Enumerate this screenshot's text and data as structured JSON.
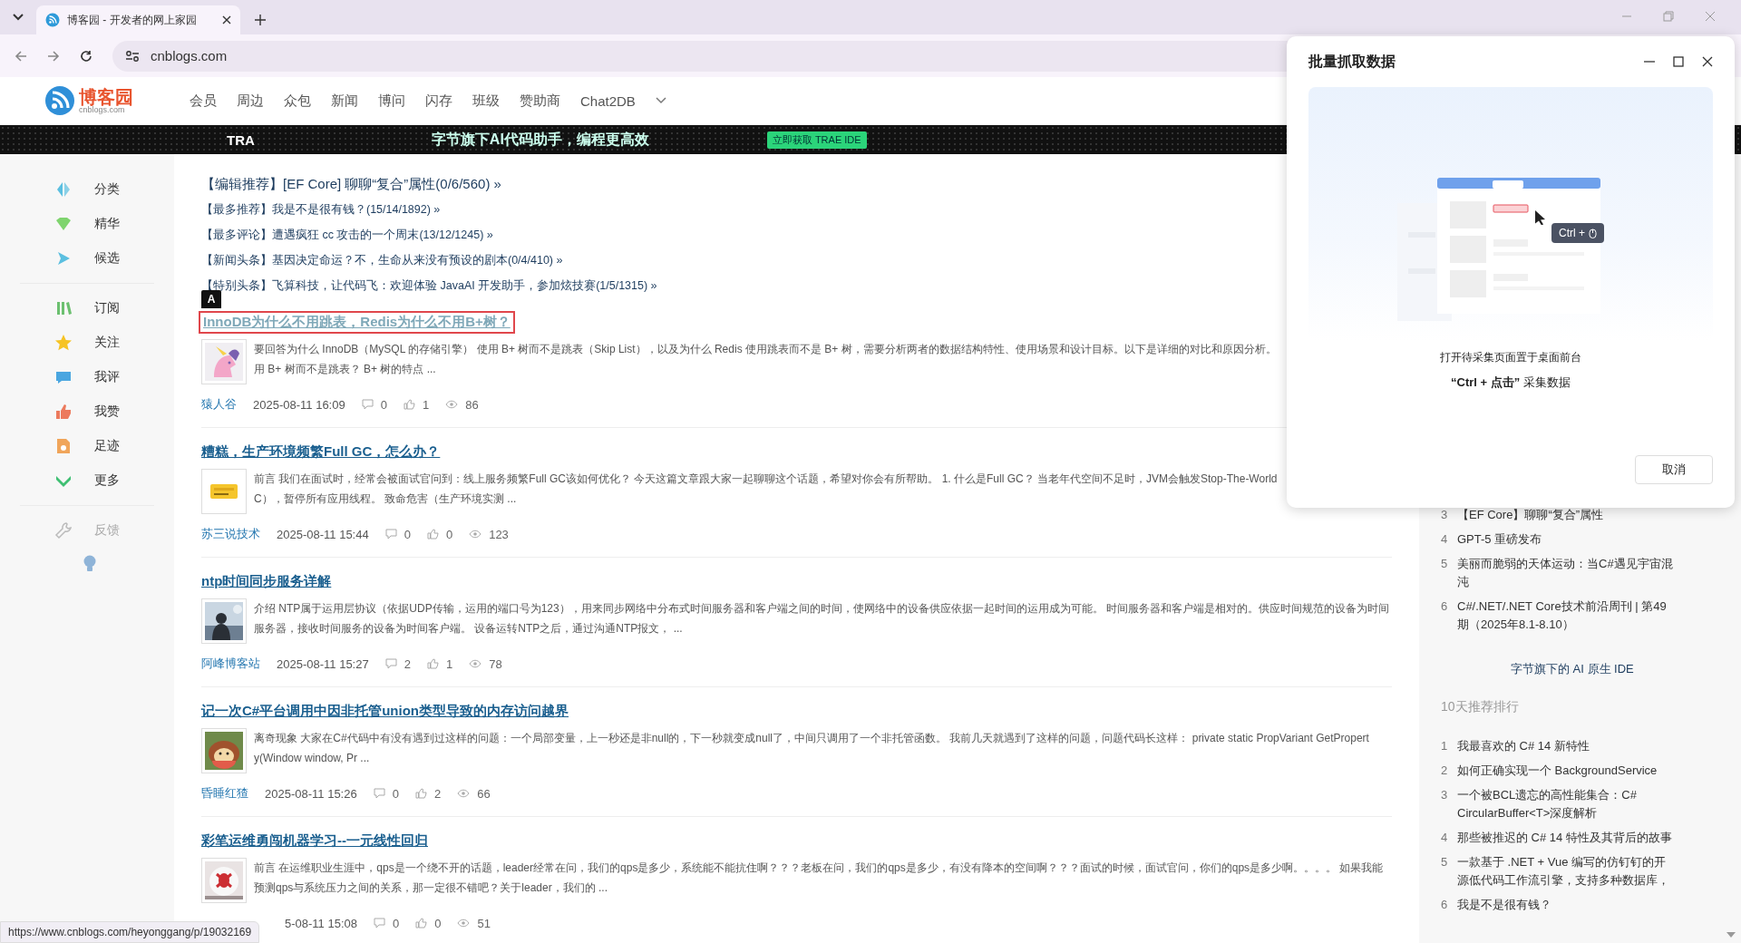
{
  "browser": {
    "tab_title": "博客园 - 开发者的网上家园",
    "url": "cnblogs.com"
  },
  "site": {
    "logo_text": "博客园",
    "logo_sub": "cnblogs.com",
    "nav": [
      "会员",
      "周边",
      "众包",
      "新闻",
      "博问",
      "闪存",
      "班级",
      "赞助商",
      "Chat2DB"
    ]
  },
  "banner": {
    "brand": "TRA",
    "slogan": "字节旗下AI代码助手，编程更高效",
    "cta": "立即获取 TRAE IDE"
  },
  "sidebar": {
    "groups": [
      [
        {
          "label": "分类",
          "disabled": false
        },
        {
          "label": "精华",
          "disabled": false
        },
        {
          "label": "候选",
          "disabled": false
        }
      ],
      [
        {
          "label": "订阅",
          "disabled": false
        },
        {
          "label": "关注",
          "disabled": false
        },
        {
          "label": "我评",
          "disabled": false
        },
        {
          "label": "我赞",
          "disabled": false
        },
        {
          "label": "足迹",
          "disabled": false
        },
        {
          "label": "更多",
          "disabled": false
        }
      ],
      [
        {
          "label": "反馈",
          "disabled": true
        }
      ]
    ]
  },
  "headlines": [
    {
      "tag": "【编辑推荐】",
      "text": "[EF Core] 聊聊“复合”属性(0/6/560) »"
    },
    {
      "tag": "【最多推荐】",
      "text": "我是不是很有钱？(15/14/1892) »"
    },
    {
      "tag": "【最多评论】",
      "text": "遭遇疯狂 cc 攻击的一个周末(13/12/1245) »"
    },
    {
      "tag": "【新闻头条】",
      "text": "基因决定命运？不，生命从来没有预设的剧本(0/4/410) »"
    },
    {
      "tag": "【特别头条】",
      "text": "飞算科技，让代码飞：欢迎体验 JavaAI 开发助手，参加炫技赛(1/5/1315) »"
    }
  ],
  "articles": [
    {
      "title": "InnoDB为什么不用跳表，Redis为什么不用B+树？",
      "highlighted": true,
      "badge": "A",
      "summary_lines": [
        "要回答为什么 InnoDB（MySQL 的存储引擎） 使用 B+ 树而不是跳表（Skip List），以及为什么 Redis 使用跳表而不是 B+ 树，需要分析两者的数据结构特性、使用场景和设计目标。以下是详细的对比和原因分析。",
        "用 B+ 树而不是跳表？ B+ 树的特点 ..."
      ],
      "author": "猿人谷",
      "date": "2025-08-11 16:09",
      "comments": "0",
      "likes": "1",
      "views": "86"
    },
    {
      "title": "糟糕，生产环境频繁Full GC，怎么办？",
      "highlighted": false,
      "summary_lines": [
        "前言 我们在面试时，经常会被面试官问到：线上服务频繁Full GC该如何优化？ 今天这篇文章跟大家一起聊聊这个话题，希望对你会有所帮助。 1. 什么是Full GC？ 当老年代空间不足时，JVM会触发Stop-The-World",
        "C），暂停所有应用线程。 致命危害（生产环境实测 ..."
      ],
      "author": "苏三说技术",
      "date": "2025-08-11 15:44",
      "comments": "0",
      "likes": "0",
      "views": "123"
    },
    {
      "title": "ntp时间同步服务详解",
      "highlighted": false,
      "summary_lines": [
        "介绍 NTP属于运用层协议（依据UDP传输，运用的端口号为123），用来同步网络中分布式时间服务器和客户端之间的时间，使网络中的设备供应依据一起时间的运用成为可能。 时间服务器和客户端是相对的。供应时间规范的设备为时间",
        "服务器，接收时间服务的设备为时间客户端。 设备运转NTP之后，通过沟通NTP报文， ..."
      ],
      "author": "阿峰博客站",
      "date": "2025-08-11 15:27",
      "comments": "2",
      "likes": "1",
      "views": "78"
    },
    {
      "title": "记一次C#平台调用中因非托管union类型导致的内存访问越界",
      "highlighted": false,
      "summary_lines": [
        "离奇现象 大家在C#代码中有没有遇到过这样的问题：一个局部变量，上一秒还是非null的，下一秒就变成null了，中间只调用了一个非托管函数。 我前几天就遇到了这样的问题，问题代码长这样： private static PropVariant GetPropert",
        "y(Window window, Pr ..."
      ],
      "author": "昏睡红猹",
      "date": "2025-08-11 15:26",
      "comments": "0",
      "likes": "2",
      "views": "66"
    },
    {
      "title": "彩笔运维勇闯机器学习--一元线性回归",
      "highlighted": false,
      "summary_lines": [
        "前言 在运维职业生涯中，qps是一个绕不开的话题，leader经常在问，我们的qps是多少，系统能不能抗住啊？？？老板在问，我们的qps是多少，有没有降本的空间啊？？？面试的时候，面试官问，你们的qps是多少啊。。。。 如果我能",
        "预测qps与系统压力之间的关系，那一定很不错吧？关于leader，我们的 ..."
      ],
      "date": "5-08-11 15:08",
      "comments": "0",
      "likes": "0",
      "views": "51"
    }
  ],
  "status_url": "https://www.cnblogs.com/heyonggang/p/19032169",
  "right": {
    "list_top": [
      {
        "rank": "3",
        "title": "【EF Core】聊聊“复合”属性"
      },
      {
        "rank": "4",
        "title": "GPT-5 重磅发布"
      },
      {
        "rank": "5",
        "title": "美丽而脆弱的天体运动：当C#遇见宇宙混沌"
      },
      {
        "rank": "6",
        "title": "C#/.NET/.NET Core技术前沿周刊 | 第49 期（2025年8.1-8.10）"
      }
    ],
    "ad_text": "字节旗下的 AI 原生 IDE",
    "ranking": {
      "heading": "10天推荐排行",
      "items": [
        {
          "rank": "1",
          "title": "我最喜欢的 C# 14 新特性"
        },
        {
          "rank": "2",
          "title": "如何正确实现一个 BackgroundService"
        },
        {
          "rank": "3",
          "title": "一个被BCL遗忘的高性能集合：C# CircularBuffer<T>深度解析"
        },
        {
          "rank": "4",
          "title": "那些被推迟的 C# 14 特性及其背后的故事"
        },
        {
          "rank": "5",
          "title": "一款基于 .NET + Vue 编写的仿钉钉的开源低代码工作流引擎，支持多种数据库，"
        },
        {
          "rank": "6",
          "title": "我是不是很有钱？"
        }
      ]
    }
  },
  "dialog": {
    "title": "批量抓取数据",
    "shortcut": "Ctrl +",
    "hint": "打开待采集页面置于桌面前台",
    "instruction": "**“Ctrl + 点击”** 采集数据",
    "cancel": "取消"
  }
}
